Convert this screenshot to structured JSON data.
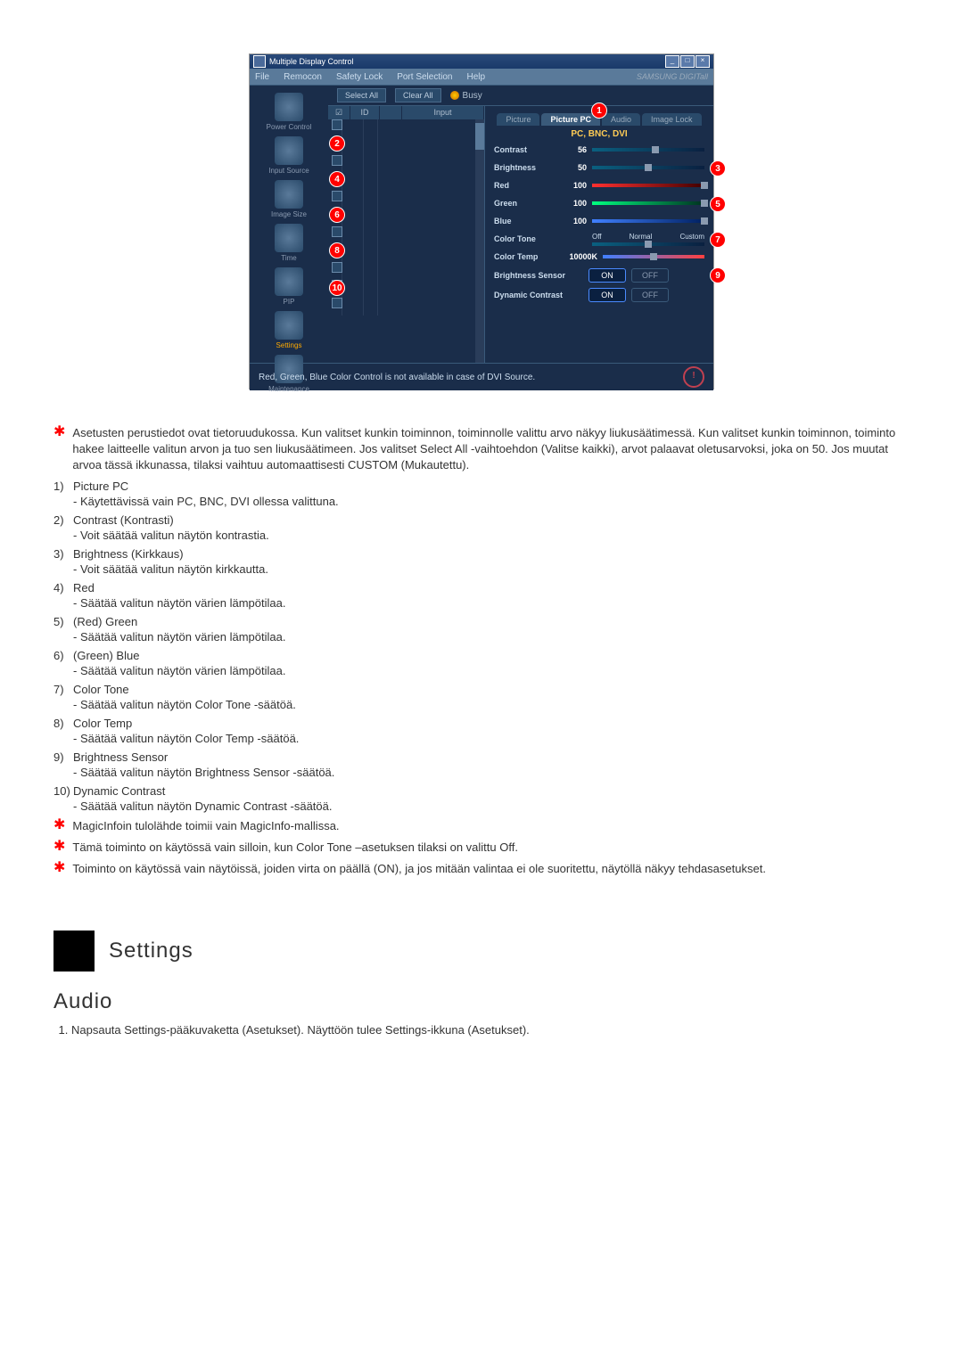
{
  "window": {
    "title": "Multiple Display Control",
    "menu": [
      "File",
      "Remocon",
      "Safety Lock",
      "Port Selection",
      "Help"
    ],
    "brand": "SAMSUNG DIGITall"
  },
  "toolbar": {
    "select_all": "Select All",
    "clear_all": "Clear All",
    "busy": "Busy"
  },
  "sidebar": {
    "items": [
      {
        "label": "Power Control"
      },
      {
        "label": "Input Source"
      },
      {
        "label": "Image Size"
      },
      {
        "label": "Time"
      },
      {
        "label": "PIP"
      },
      {
        "label": "Settings"
      },
      {
        "label": "Maintenance"
      }
    ],
    "active_index": 5
  },
  "table": {
    "headers": {
      "chk": "☑",
      "id": "ID",
      "ico": "",
      "input": "Input"
    },
    "row_count": 11
  },
  "picture": {
    "tabs": [
      "Picture",
      "Picture PC",
      "Audio",
      "Image Lock"
    ],
    "active_tab": 1,
    "subhead": "PC, BNC, DVI",
    "rows": {
      "contrast": {
        "label": "Contrast",
        "value": "56",
        "pos": 56
      },
      "brightness": {
        "label": "Brightness",
        "value": "50",
        "pos": 50
      },
      "red": {
        "label": "Red",
        "value": "100",
        "pos": 100
      },
      "green": {
        "label": "Green",
        "value": "100",
        "pos": 100
      },
      "blue": {
        "label": "Blue",
        "value": "100",
        "pos": 100
      },
      "color_tone": {
        "label": "Color Tone",
        "opts": [
          "Off",
          "Normal",
          "Custom"
        ],
        "pos": 50
      },
      "color_temp": {
        "label": "Color Temp",
        "value": "10000K",
        "pos": 50
      },
      "brightness_sensor": {
        "label": "Brightness Sensor",
        "on": "ON",
        "off": "OFF"
      },
      "dynamic_contrast": {
        "label": "Dynamic Contrast",
        "on": "ON",
        "off": "OFF"
      }
    },
    "markers": {
      "m1": "1",
      "m2": "2",
      "m3": "3",
      "m4": "4",
      "m5": "5",
      "m6": "6",
      "m7": "7",
      "m8": "8",
      "m9": "9",
      "m10": "10"
    }
  },
  "footer": {
    "text": "Red, Green, Blue Color Control is not available in case of DVI Source.",
    "warn": "!"
  },
  "notes": {
    "star1": "Asetusten perustiedot ovat tietoruudukossa. Kun valitset kunkin toiminnon, toiminnolle valittu arvo näkyy liukusäätimessä. Kun valitset kunkin toiminnon, toiminto hakee laitteelle valitun arvon ja tuo sen liukusäätimeen. Jos valitset Select All -vaihtoehdon (Valitse kaikki), arvot palaavat oletusarvoksi, joka on 50. Jos muutat arvoa tässä ikkunassa, tilaksi vaihtuu automaattisesti CUSTOM (Mukautettu).",
    "list": [
      {
        "num": "1)",
        "title": "Picture PC",
        "desc": "- Käytettävissä vain PC, BNC, DVI ollessa valittuna."
      },
      {
        "num": "2)",
        "title": "Contrast (Kontrasti)",
        "desc": "- Voit säätää valitun näytön kontrastia."
      },
      {
        "num": "3)",
        "title": "Brightness (Kirkkaus)",
        "desc": "- Voit säätää valitun näytön kirkkautta."
      },
      {
        "num": "4)",
        "title": "Red",
        "desc": "- Säätää valitun näytön värien lämpötilaa."
      },
      {
        "num": "5)",
        "title": "(Red) Green",
        "desc": "- Säätää valitun näytön värien lämpötilaa."
      },
      {
        "num": "6)",
        "title": "(Green) Blue",
        "desc": "- Säätää valitun näytön värien lämpötilaa."
      },
      {
        "num": "7)",
        "title": "Color Tone",
        "desc": "- Säätää valitun näytön Color Tone -säätöä."
      },
      {
        "num": "8)",
        "title": "Color Temp",
        "desc": "- Säätää valitun näytön Color Temp -säätöä."
      },
      {
        "num": "9)",
        "title": "Brightness Sensor",
        "desc": "- Säätää valitun näytön Brightness Sensor -säätöä."
      },
      {
        "num": "10)",
        "title": "Dynamic Contrast",
        "desc": "- Säätää valitun näytön Dynamic Contrast -säätöä."
      }
    ],
    "star2": "MagicInfoin tulolähde toimii vain MagicInfo-mallissa.",
    "star3": "Tämä toiminto on käytössä vain silloin, kun Color Tone –asetuksen tilaksi on valittu Off.",
    "star4": "Toiminto on käytössä vain näytöissä, joiden virta on päällä (ON), ja jos mitään valintaa ei ole suoritettu, näytöllä näkyy tehdasasetukset."
  },
  "section": {
    "heading": "Settings",
    "sub": "Audio",
    "sub_list_1": "Napsauta Settings-pääkuvaketta (Asetukset). Näyttöön tulee Settings-ikkuna (Asetukset)."
  }
}
